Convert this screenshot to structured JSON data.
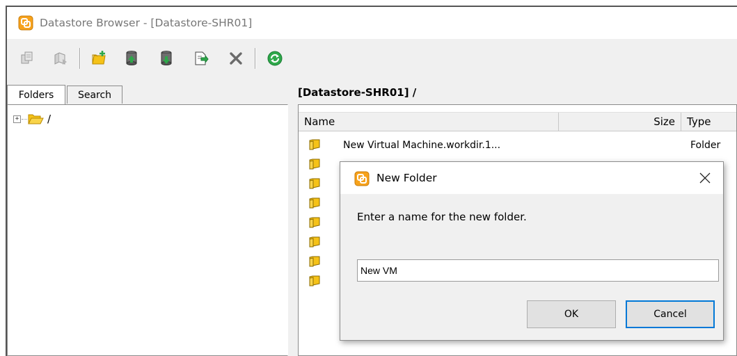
{
  "window": {
    "title": "Datastore Browser - [Datastore-SHR01]"
  },
  "toolbar": {
    "icons": [
      "upload-icon",
      "download-icon",
      "new-folder-icon",
      "datastore-upload-icon",
      "datastore-download-icon",
      "move-icon",
      "delete-icon",
      "refresh-icon"
    ],
    "colors": {
      "folder": "#f5c218",
      "green": "#2ea84a",
      "delete": "#6b6b6b"
    }
  },
  "left_pane": {
    "tabs": [
      "Folders",
      "Search"
    ],
    "active_tab": "Folders",
    "tree": [
      {
        "expander": "+",
        "label": "/"
      }
    ]
  },
  "right_pane": {
    "path": "[Datastore-SHR01] /",
    "columns": {
      "name": "Name",
      "size": "Size",
      "type": "Type"
    },
    "rows": [
      {
        "name": "New Virtual Machine.workdir.1...",
        "type": "Folder"
      },
      {
        "name": "",
        "type": ""
      },
      {
        "name": "",
        "type": ""
      },
      {
        "name": "",
        "type": ""
      },
      {
        "name": "",
        "type": ""
      },
      {
        "name": "",
        "type": ""
      },
      {
        "name": "",
        "type": ""
      },
      {
        "name": "",
        "type": ""
      }
    ]
  },
  "dialog": {
    "title": "New Folder",
    "prompt": "Enter a name for the new folder.",
    "input_value": "New VM",
    "ok_label": "OK",
    "cancel_label": "Cancel",
    "close_glyph": "✕"
  }
}
